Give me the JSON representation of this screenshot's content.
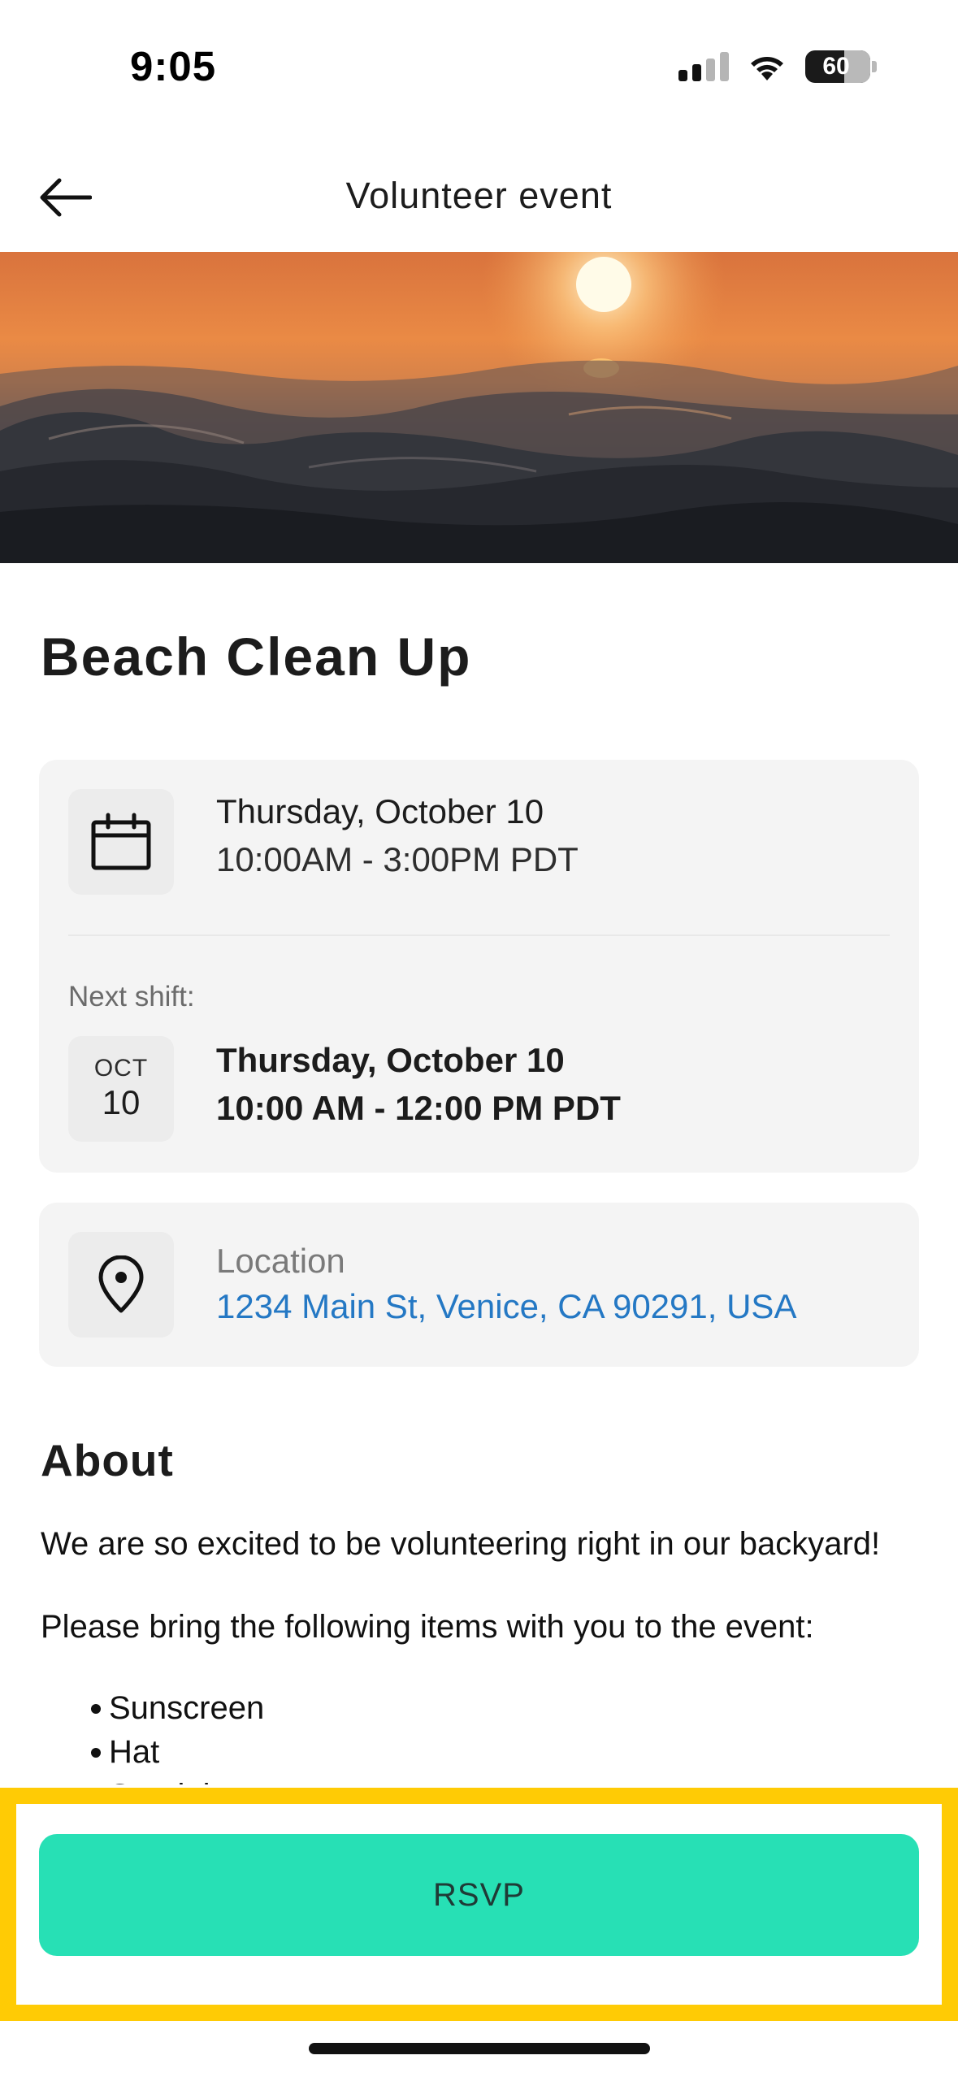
{
  "status_bar": {
    "time": "9:05",
    "battery_level": "60",
    "icons": [
      "cellular-signal-icon",
      "wifi-icon",
      "battery-icon"
    ]
  },
  "header": {
    "title": "Volunteer event",
    "back_icon": "arrow-left-icon"
  },
  "hero": {
    "icon": "sunset-ocean-image"
  },
  "event": {
    "title": "Beach Clean Up",
    "date_card": {
      "date_label": "Thursday, October 10",
      "time_range": "10:00AM - 3:00PM PDT",
      "icon": "calendar-icon",
      "next_shift_label": "Next shift:",
      "next_shift": {
        "month": "OCT",
        "day": "10",
        "date_label": "Thursday, October 10",
        "time_range": "10:00 AM - 12:00 PM PDT"
      }
    },
    "location_card": {
      "label": "Location",
      "address": "1234 Main St, Venice, CA 90291, USA",
      "icon": "map-pin-icon"
    }
  },
  "about": {
    "heading": "About",
    "paragraph_1": "We are so excited to be volunteering right in our backyard!",
    "paragraph_2": "Please bring the following items with you to the event:",
    "items": [
      "Sunscreen",
      "Hat",
      "Sandals"
    ]
  },
  "actions": {
    "rsvp_label": "RSVP"
  },
  "colors": {
    "accent": "#27e0b5",
    "link": "#2478c4",
    "highlight": "#ffcb05",
    "card_bg": "#f4f4f4"
  }
}
